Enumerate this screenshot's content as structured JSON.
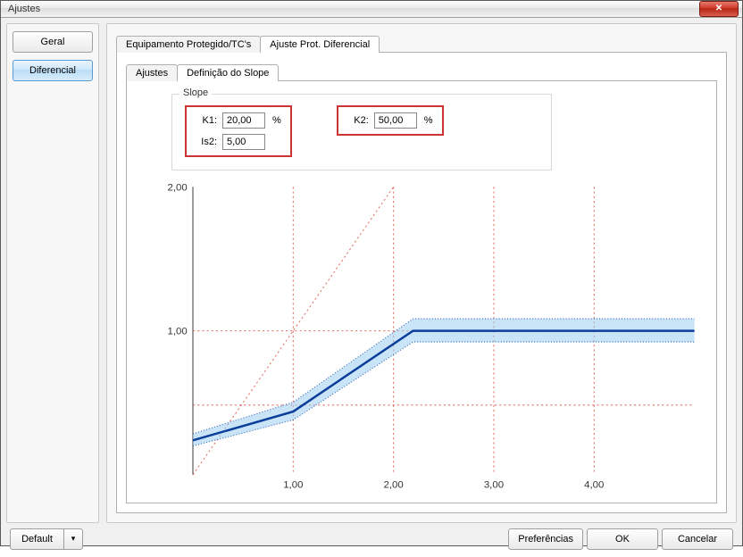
{
  "window": {
    "title": "Ajustes"
  },
  "sidebar": {
    "items": [
      {
        "label": "Geral"
      },
      {
        "label": "Diferencial"
      }
    ]
  },
  "tabs_outer": [
    {
      "label": "Equipamento Protegido/TC's"
    },
    {
      "label": "Ajuste Prot. Diferencial"
    }
  ],
  "tabs_inner": [
    {
      "label": "Ajustes"
    },
    {
      "label": "Definição do Slope"
    }
  ],
  "slope": {
    "legend": "Slope",
    "k1_label": "K1:",
    "k1_value": "20,00",
    "k1_unit": "%",
    "is2_label": "Is2:",
    "is2_value": "5,00",
    "k2_label": "K2:",
    "k2_value": "50,00",
    "k2_unit": "%"
  },
  "buttons": {
    "default": "Default",
    "preferences": "Preferências",
    "ok": "OK",
    "cancel": "Cancelar"
  },
  "chart_data": {
    "type": "line",
    "x_ticks": [
      "1,00",
      "2,00",
      "3,00",
      "4,00"
    ],
    "y_ticks": [
      "1,00",
      "2,00"
    ],
    "xlim": [
      0,
      5
    ],
    "ylim": [
      0,
      2
    ],
    "guide_line": {
      "points": [
        [
          0,
          0
        ],
        [
          2,
          2
        ]
      ]
    },
    "series": [
      {
        "name": "slope-curve-lower",
        "points": [
          [
            0,
            0.2
          ],
          [
            1.0,
            0.38
          ],
          [
            2.2,
            0.92
          ],
          [
            5.0,
            0.92
          ]
        ]
      },
      {
        "name": "slope-curve-center",
        "points": [
          [
            0,
            0.24
          ],
          [
            1.0,
            0.44
          ],
          [
            2.2,
            1.0
          ],
          [
            5.0,
            1.0
          ]
        ]
      },
      {
        "name": "slope-curve-upper",
        "points": [
          [
            0,
            0.28
          ],
          [
            1.0,
            0.5
          ],
          [
            2.2,
            1.08
          ],
          [
            5.0,
            1.08
          ]
        ]
      }
    ]
  }
}
